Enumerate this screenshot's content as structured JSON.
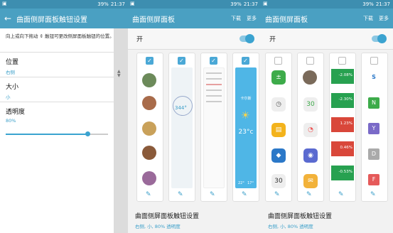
{
  "status_bar": {
    "signal": "39%",
    "time": "21:37"
  },
  "screen1": {
    "title": "曲面侧屏面板触钮设置",
    "hint": "向上或向下拖动 ⇕ 触钮可更改侧屏面板触钮的位置。",
    "settings": [
      {
        "label": "位置",
        "value": "右侧"
      },
      {
        "label": "大小",
        "value": "小"
      },
      {
        "label": "透明度",
        "value": "80%"
      }
    ],
    "opacity": 0.8
  },
  "screen2": {
    "title": "曲面侧屏面板",
    "actions": [
      "下载",
      "更多"
    ],
    "toggle_label": "开",
    "footer_title": "曲面侧屏面板触钮设置",
    "footer_sub": "右侧, 小, 80% 透明度",
    "compass_value": "344°",
    "weather_temp": "23°c",
    "weather_city": "卡尔斯",
    "weather_range": [
      "22°",
      "17°"
    ]
  },
  "screen3": {
    "title": "曲面侧屏面板",
    "actions": [
      "下载",
      "更多"
    ],
    "toggle_label": "开",
    "footer_title": "曲面侧屏面板触钮设置",
    "footer_sub": "右侧, 小, 80% 透明度",
    "stocks": [
      "-2.08%",
      "-2.30%",
      "1.23%",
      "0.46%",
      "-0.53%"
    ],
    "letters": [
      "S",
      "N",
      "Y",
      "D",
      "F"
    ]
  },
  "colors": {
    "accent": "#4aa0c2",
    "blue": "#3b9fc9",
    "gain": "#d9473a",
    "loss": "#27a150"
  }
}
